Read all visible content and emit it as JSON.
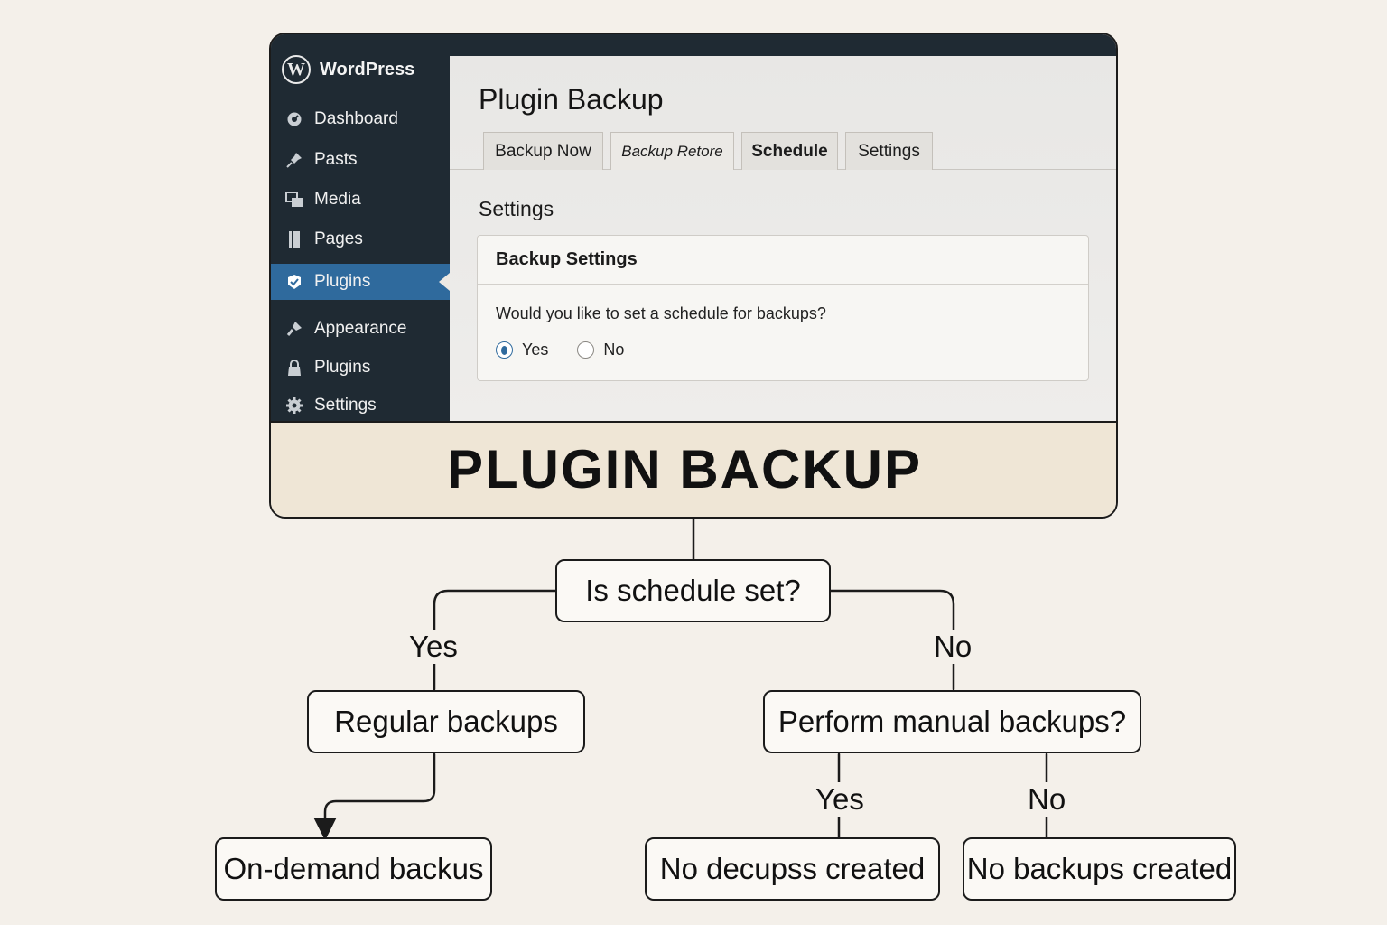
{
  "sidebar": {
    "brand": "WordPress",
    "brand_logo": "W",
    "items": [
      {
        "label": "Dashboard",
        "icon": "gauge-icon"
      },
      {
        "label": "Pasts",
        "icon": "pin-icon"
      },
      {
        "label": "Media",
        "icon": "media-icon"
      },
      {
        "label": "Pages",
        "icon": "pages-icon"
      },
      {
        "label": "Plugins",
        "icon": "plugin-icon",
        "active": true
      },
      {
        "label": "Appearance",
        "icon": "brush-icon"
      },
      {
        "label": "Plugins",
        "icon": "lock-icon"
      },
      {
        "label": "Settings",
        "icon": "gear-icon"
      }
    ]
  },
  "main": {
    "title": "Plugin Backup",
    "tabs": [
      "Backup Now",
      "Backup Retore",
      "Schedule",
      "Settings"
    ],
    "section_heading": "Settings",
    "card": {
      "title": "Backup Settings",
      "question": "Would you like to set a schedule for backups?",
      "options": [
        {
          "label": "Yes",
          "selected": true
        },
        {
          "label": "No",
          "selected": false
        }
      ]
    }
  },
  "banner": "PLUGIN BACKUP",
  "flowchart": {
    "root": "Is schedule set?",
    "yes_label": "Yes",
    "no_label": "No",
    "yes_node": "Regular backups",
    "no_node": "Perform manual backups?",
    "yes_leaf": "On-demand backus",
    "manual_yes_label": "Yes",
    "manual_no_label": "No",
    "manual_yes_leaf": "No decupss created",
    "manual_no_leaf": "No backups created"
  },
  "colors": {
    "sidebar_bg": "#1f2a33",
    "active_item": "#2f6a9d",
    "page_bg": "#f4f0ea",
    "banner_bg": "#efe6d6"
  }
}
